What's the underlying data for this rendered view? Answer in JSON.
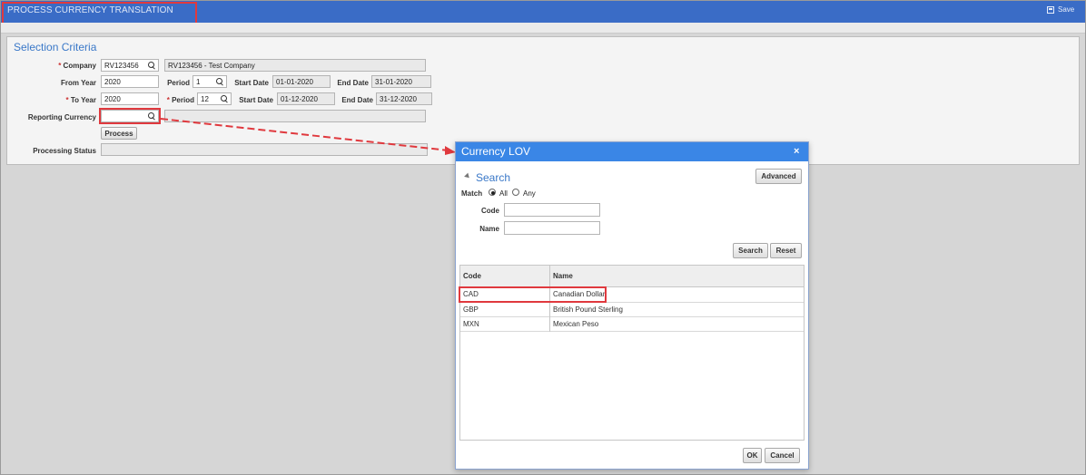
{
  "app": {
    "title": "PROCESS CURRENCY TRANSLATION",
    "save_label": "Save"
  },
  "selection": {
    "title": "Selection Criteria",
    "company": {
      "label": "Company",
      "code": "RV123456",
      "name": "RV123456 - Test Company"
    },
    "from_year": {
      "label": "From Year",
      "value": "2020"
    },
    "from_period": {
      "label": "Period",
      "value": "1"
    },
    "from_start": {
      "label": "Start Date",
      "value": "01-01-2020"
    },
    "from_end": {
      "label": "End Date",
      "value": "31-01-2020"
    },
    "to_year": {
      "label": "To Year",
      "value": "2020"
    },
    "to_period": {
      "label": "Period",
      "value": "12"
    },
    "to_start": {
      "label": "Start Date",
      "value": "01-12-2020"
    },
    "to_end": {
      "label": "End Date",
      "value": "31-12-2020"
    },
    "reporting_currency": {
      "label": "Reporting Currency",
      "value": ""
    },
    "process_label": "Process",
    "processing_status": {
      "label": "Processing Status",
      "value": ""
    },
    "required_mark": "*"
  },
  "dialog": {
    "title": "Currency LOV",
    "close": "×",
    "search_title": "Search",
    "advanced_label": "Advanced",
    "match_label": "Match",
    "match_all": "All",
    "match_any": "Any",
    "code_label": "Code",
    "name_label": "Name",
    "search_btn": "Search",
    "reset_btn": "Reset",
    "columns": [
      "Code",
      "Name"
    ],
    "rows": [
      {
        "code": "CAD",
        "name": "Canadian Dollar"
      },
      {
        "code": "GBP",
        "name": "British Pound Sterling"
      },
      {
        "code": "MXN",
        "name": "Mexican Peso"
      }
    ],
    "ok_btn": "OK",
    "cancel_btn": "Cancel"
  },
  "colors": {
    "titlebar": "#3a6cc6",
    "dialog_title": "#3a86e6",
    "highlight": "#e0393e",
    "section_title": "#3a78c8"
  }
}
